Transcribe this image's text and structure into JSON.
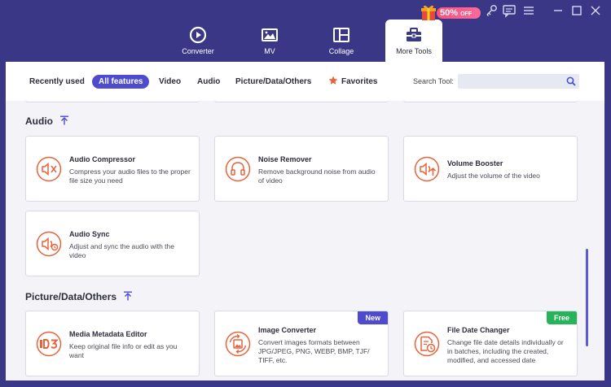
{
  "window": {
    "promo_text": "50%",
    "promo_suffix": "OFF",
    "tabs": [
      {
        "label": "Converter",
        "icon": "converter-icon"
      },
      {
        "label": "MV",
        "icon": "mv-icon"
      },
      {
        "label": "Collage",
        "icon": "collage-icon"
      },
      {
        "label": "More Tools",
        "icon": "toolbox-icon",
        "active": true
      }
    ]
  },
  "filters": {
    "items": [
      "Recently used",
      "All features",
      "Video",
      "Audio",
      "Picture/Data/Others",
      "Favorites"
    ],
    "active": "All features",
    "search_label": "Search Tool:",
    "search_value": ""
  },
  "sections": {
    "audio": {
      "title": "Audio",
      "cards": [
        {
          "title": "Audio Compressor",
          "desc": "Compress your audio files to the proper file size you need",
          "icon": "audio-compress-icon"
        },
        {
          "title": "Noise Remover",
          "desc": "Remove background noise from audio of video",
          "icon": "headphones-icon"
        },
        {
          "title": "Volume Booster",
          "desc": "Adjust the volume of the video",
          "icon": "volume-booster-icon"
        },
        {
          "title": "Audio Sync",
          "desc": "Adjust and sync the audio with the video",
          "icon": "audio-sync-icon"
        }
      ]
    },
    "picture": {
      "title": "Picture/Data/Others",
      "cards": [
        {
          "title": "Media Metadata Editor",
          "desc": "Keep original file info or edit as you want",
          "icon": "id3-icon"
        },
        {
          "title": "Image Converter",
          "desc": "Convert images formats between JPG/JPEG, PNG, WEBP, BMP, TJF/ TIFF, etc.",
          "icon": "image-convert-icon",
          "badge": "New"
        },
        {
          "title": "File Date Changer",
          "desc": "Change file date details individually or in batches, including the created, modified, and accessed date",
          "icon": "file-date-icon",
          "badge": "Free"
        }
      ]
    }
  },
  "colors": {
    "titlebar": "#3a3787",
    "accent": "#4e4bcf",
    "icon_orange": "#e8623a",
    "badge_new": "#4e4bcf",
    "badge_free": "#27b35a",
    "promo": "#ff4f7b"
  }
}
